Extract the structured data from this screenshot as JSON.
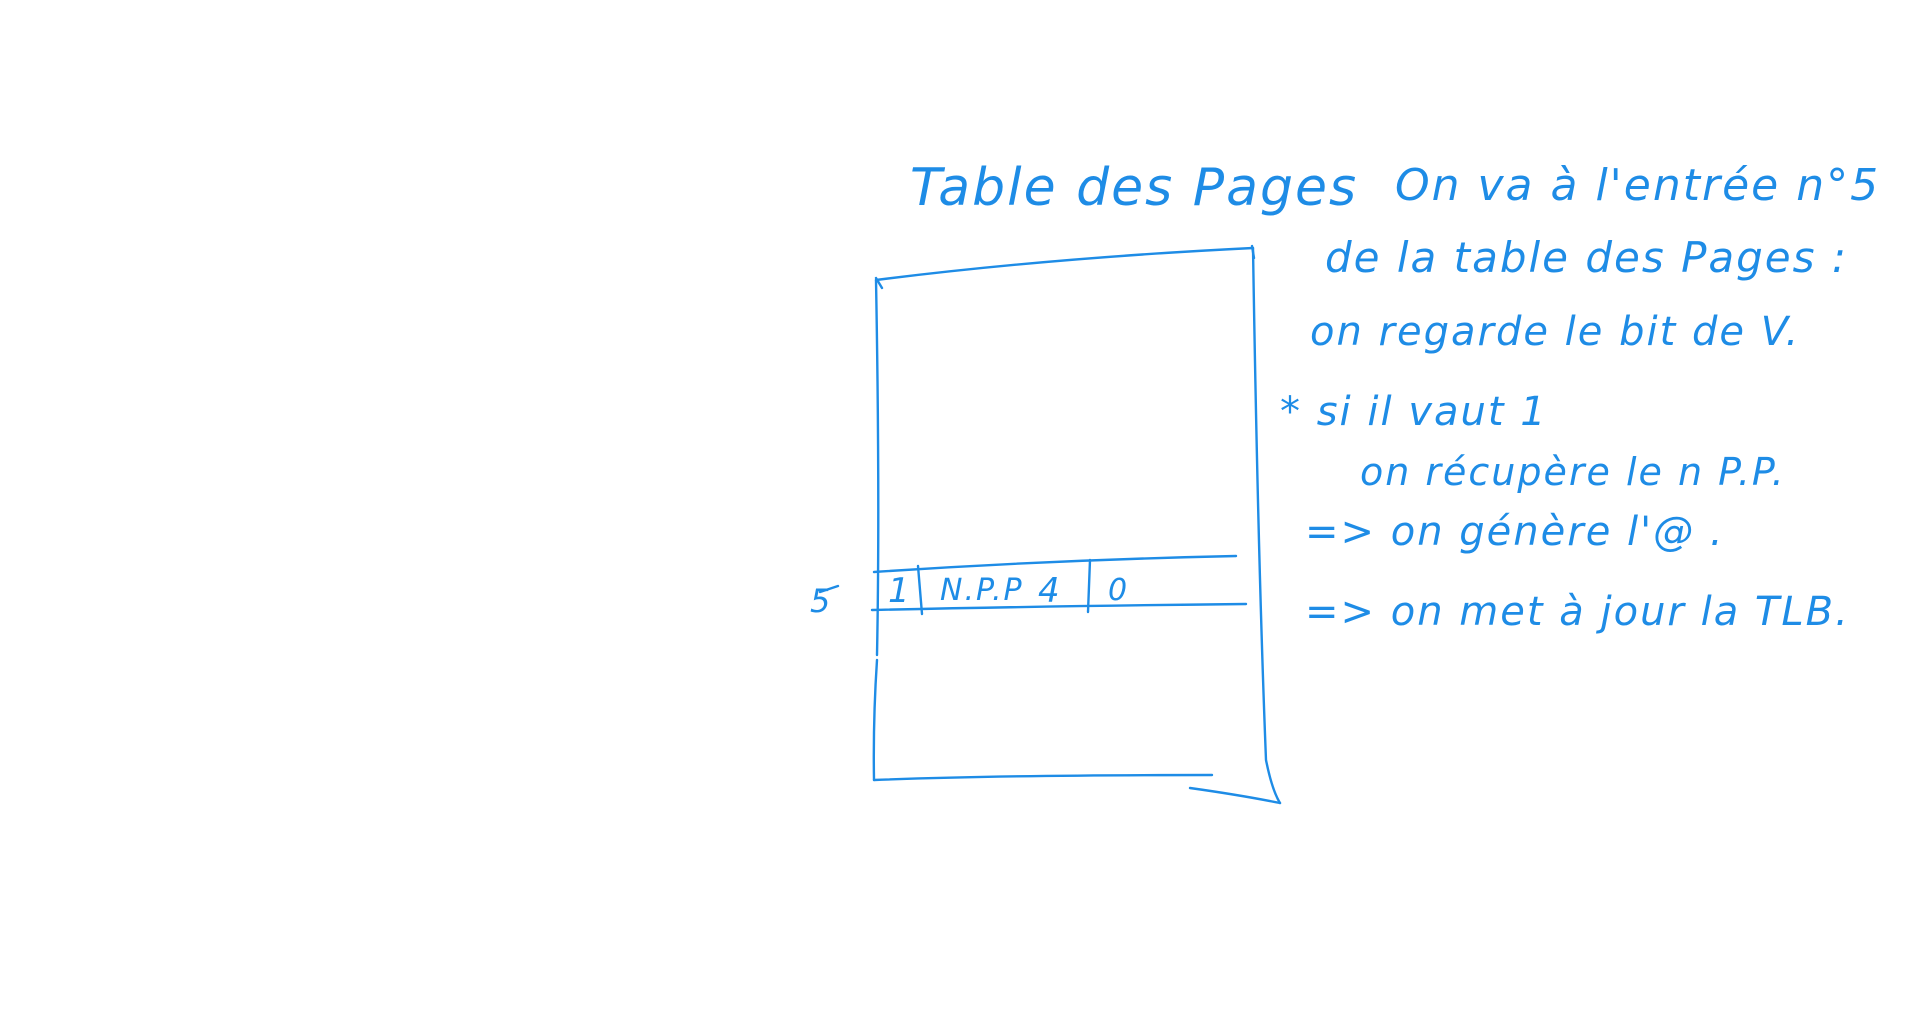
{
  "ink_color": "#1e8ce6",
  "table": {
    "title": "Table des Pages",
    "entry_index": "5",
    "entry": {
      "v_bit": "1",
      "npp": "N.P.P",
      "npp_value": "4",
      "last_bit": "0"
    }
  },
  "notes": {
    "line1": "On va à l'entrée n°5",
    "line2": "de la table des Pages :",
    "line3": "on regarde le bit de V.",
    "line4": "* si il vaut 1",
    "line5": "on récupère le n P.P.",
    "line6": "=> on génère l'@ .",
    "line7": "=> on met à jour la TLB."
  }
}
